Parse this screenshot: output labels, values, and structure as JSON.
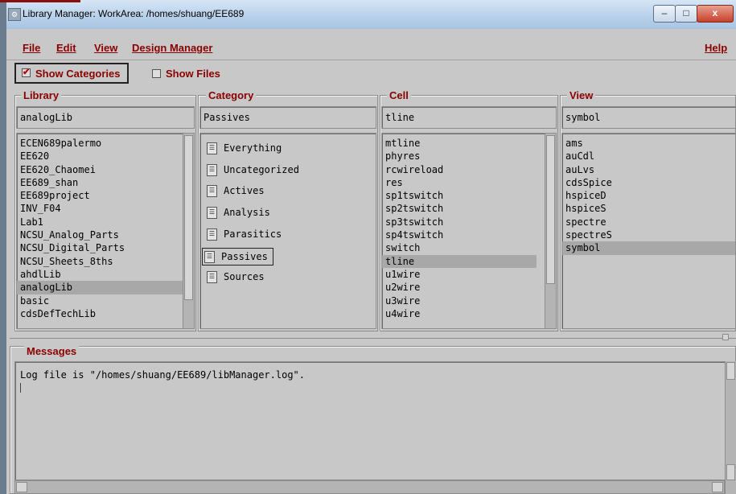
{
  "window": {
    "title": "Library Manager: WorkArea: /homes/shuang/EE689",
    "minimize_glyph": "–",
    "maximize_glyph": "□",
    "close_glyph": "x"
  },
  "menu": {
    "file": "File",
    "edit": "Edit",
    "view": "View",
    "design_manager": "Design Manager",
    "help": "Help"
  },
  "toolbar": {
    "show_categories": {
      "label": "Show Categories",
      "checked": true
    },
    "show_files": {
      "label": "Show Files",
      "checked": false
    }
  },
  "library": {
    "label": "Library",
    "value": "analogLib",
    "items": [
      "ECEN689palermo",
      "EE620",
      "EE620_Chaomei",
      "EE689_shan",
      "EE689project",
      "INV_F04",
      "Lab1",
      "NCSU_Analog_Parts",
      "NCSU_Digital_Parts",
      "NCSU_Sheets_8ths",
      "ahdlLib",
      "analogLib",
      "basic",
      "cdsDefTechLib"
    ],
    "selected": "analogLib"
  },
  "category": {
    "label": "Category",
    "value": "Passives",
    "items": [
      "Everything",
      "Uncategorized",
      "Actives",
      "Analysis",
      "Parasitics",
      "Passives",
      "Sources"
    ],
    "selected": "Passives",
    "icon": "category-icon"
  },
  "cell": {
    "label": "Cell",
    "value": "tline",
    "items": [
      "mtline",
      "phyres",
      "rcwireload",
      "res",
      "sp1tswitch",
      "sp2tswitch",
      "sp3tswitch",
      "sp4tswitch",
      "switch",
      "tline",
      "u1wire",
      "u2wire",
      "u3wire",
      "u4wire"
    ],
    "selected": "tline"
  },
  "view": {
    "label": "View",
    "value": "symbol",
    "items": [
      "ams",
      "auCdl",
      "auLvs",
      "cdsSpice",
      "hspiceD",
      "hspiceS",
      "spectre",
      "spectreS",
      "symbol"
    ],
    "selected": "symbol"
  },
  "messages": {
    "label": "Messages",
    "log_line": "Log file is \"/homes/shuang/EE689/libManager.log\"."
  }
}
